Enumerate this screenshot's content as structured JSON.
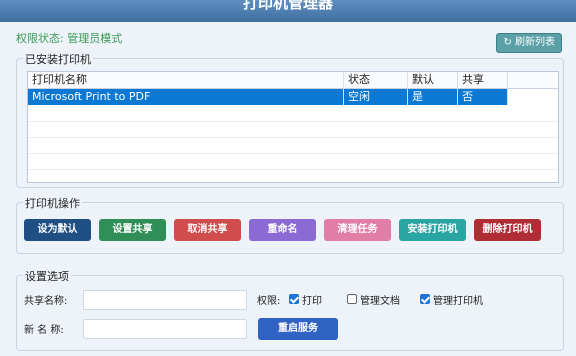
{
  "window": {
    "title": "打印机管理器"
  },
  "status_text": "权限状态: 管理员模式",
  "refresh_label": "↻ 刷新列表",
  "installed_group": {
    "title": "已安装打印机",
    "columns": [
      "打印机名称",
      "状态",
      "默认",
      "共享"
    ],
    "rows": [
      {
        "name": "Microsoft Print to PDF",
        "status": "空闲",
        "default": "是",
        "shared": "否"
      }
    ]
  },
  "operations_group": {
    "title": "打印机操作",
    "buttons": [
      {
        "label": "设为默认",
        "color": "#1f4f83"
      },
      {
        "label": "设置共享",
        "color": "#2f8f56"
      },
      {
        "label": "取消共享",
        "color": "#d04d4d"
      },
      {
        "label": "重命名",
        "color": "#8b6ad4"
      },
      {
        "label": "清理任务",
        "color": "#e07ea5"
      },
      {
        "label": "安装打印机",
        "color": "#2aa6a2"
      },
      {
        "label": "删除打印机",
        "color": "#b02d35"
      }
    ]
  },
  "settings_group": {
    "title": "设置选项",
    "share_name_label": "共享名称:",
    "share_name_value": "",
    "new_name_label": "新 名 称:",
    "new_name_value": "",
    "permission_label": "权限:",
    "permissions": [
      {
        "label": "打印",
        "checked": true
      },
      {
        "label": "管理文档",
        "checked": false
      },
      {
        "label": "管理打印机",
        "checked": true
      }
    ],
    "restart_label": "重启服务"
  }
}
